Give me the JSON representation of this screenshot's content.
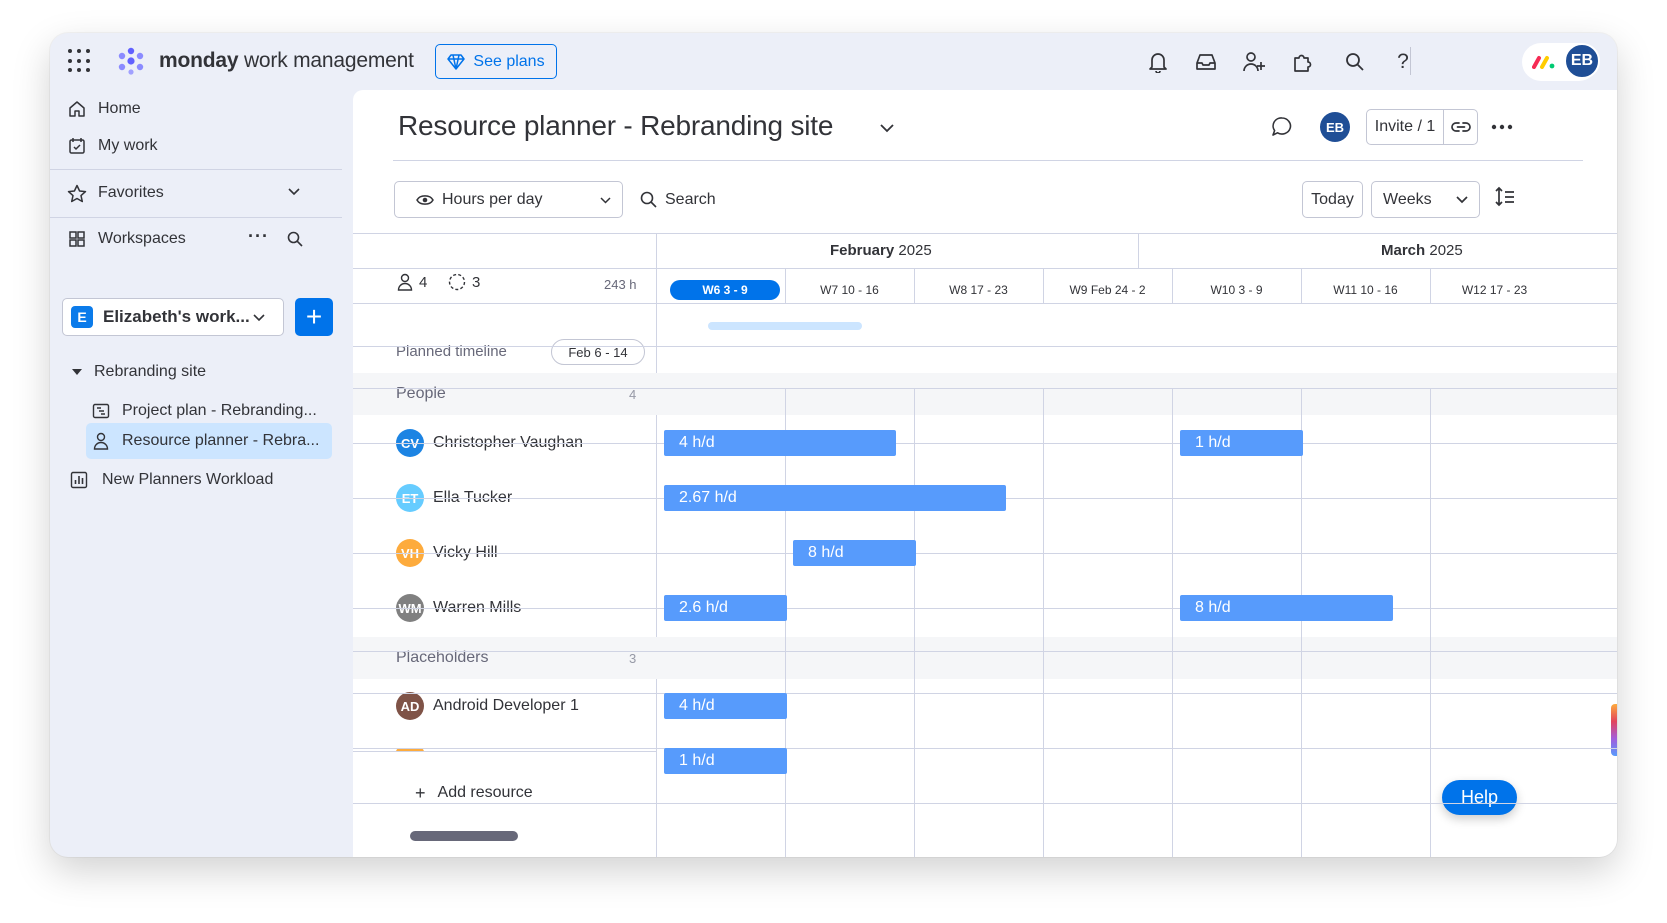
{
  "topbar": {
    "brand_bold": "monday",
    "brand_rest": " work management",
    "see_plans": "See plans",
    "user_initials": "EB"
  },
  "sidebar": {
    "home": "Home",
    "my_work": "My work",
    "favorites": "Favorites",
    "workspaces": "Workspaces",
    "workspace_badge": "E",
    "workspace_name": "Elizabeth's work...",
    "folder": "Rebranding site",
    "items": [
      {
        "label": "Project plan - Rebranding..."
      },
      {
        "label": "Resource planner - Rebra..."
      }
    ],
    "workload": "New Planners Workload"
  },
  "header": {
    "title": "Resource planner - Rebranding site",
    "user_initials": "EB",
    "invite": "Invite / 1"
  },
  "toolbar": {
    "view": "Hours per day",
    "search": "Search",
    "today": "Today",
    "scale": "Weeks"
  },
  "summary": {
    "people_count": "4",
    "placeholder_count": "3",
    "total_hours": "243 h"
  },
  "planned_timeline": {
    "label": "Planned timeline",
    "range": "Feb 6 - 14",
    "start_week_index": 0.4,
    "end_week_index": 1.6
  },
  "months": [
    {
      "name": "February",
      "year": "2025"
    },
    {
      "name": "March",
      "year": "2025"
    }
  ],
  "weeks": [
    "W6 3 - 9",
    "W7 10 - 16",
    "W8 17 - 23",
    "W9 Feb 24 - 2",
    "W10 3 - 9",
    "W11 10 - 16",
    "W12 17 - 23"
  ],
  "current_week_index": 0,
  "groups": {
    "people": {
      "label": "People",
      "count": "4"
    },
    "placeholders": {
      "label": "Placeholders",
      "count": "3"
    }
  },
  "people": [
    {
      "initials": "CV",
      "name": "Christopher Vaughan",
      "color": "#1c84e3"
    },
    {
      "initials": "ET",
      "name": "Ella Tucker",
      "color": "#66ccff"
    },
    {
      "initials": "VH",
      "name": "Vicky Hill",
      "color": "#fdab3d"
    },
    {
      "initials": "WM",
      "name": "Warren Mills",
      "color": "#808080"
    }
  ],
  "placeholders": [
    {
      "initials": "AD",
      "name": "Android Developer 1",
      "color": "#7f5347"
    }
  ],
  "allocations": {
    "people": [
      [
        {
          "label": "4 h/d",
          "start": 0,
          "weeks": 1.8
        },
        {
          "label": "1 h/d",
          "start": 4,
          "weeks": 0.95
        }
      ],
      [
        {
          "label": "2.67 h/d",
          "start": 0,
          "weeks": 2.65
        }
      ],
      [
        {
          "label": "8 h/d",
          "start": 1,
          "weeks": 0.95
        }
      ],
      [
        {
          "label": "2.6 h/d",
          "start": 0,
          "weeks": 0.95
        },
        {
          "label": "8 h/d",
          "start": 4,
          "weeks": 1.65
        }
      ]
    ],
    "placeholders": [
      [
        {
          "label": "4 h/d",
          "start": 0,
          "weeks": 0.95
        }
      ],
      [
        {
          "label": "1 h/d",
          "start": 0,
          "weeks": 0.95
        }
      ]
    ]
  },
  "add_resource": "Add resource",
  "help": "Help",
  "colors": {
    "primary": "#0073ea",
    "bar": "#579bfc",
    "timeline": "#cce5ff"
  }
}
